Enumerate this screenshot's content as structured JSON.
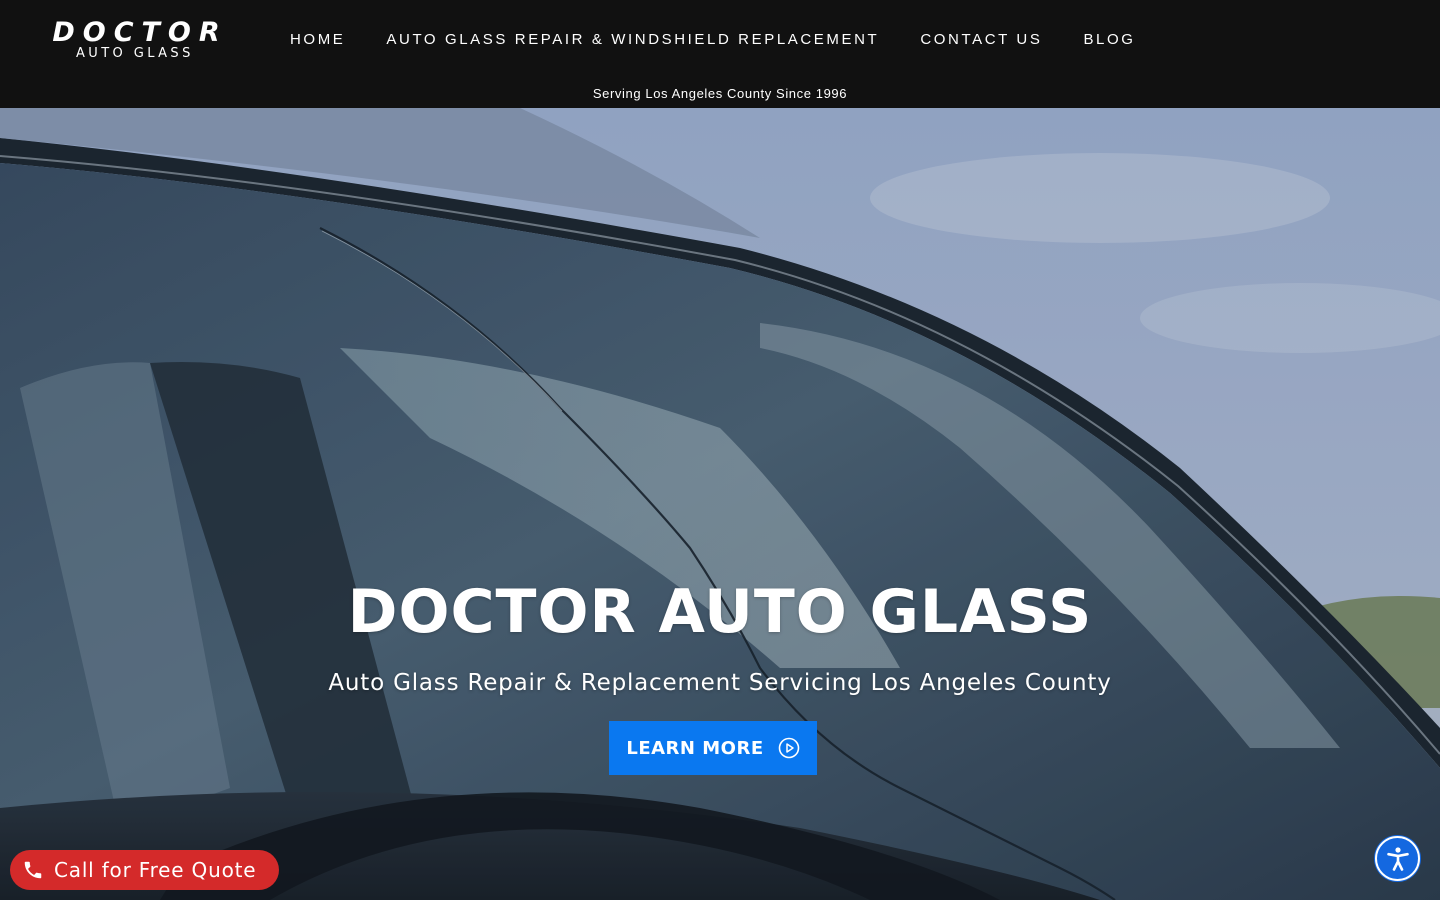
{
  "header": {
    "logo": {
      "main": "DOCTOR",
      "sub": "AUTO GLASS"
    },
    "nav": [
      {
        "label": "HOME"
      },
      {
        "label": "AUTO GLASS REPAIR & WINDSHIELD REPLACEMENT"
      },
      {
        "label": "CONTACT US"
      },
      {
        "label": "BLOG"
      }
    ],
    "tagline": "Serving Los Angeles County Since 1996"
  },
  "hero": {
    "title": "DOCTOR AUTO GLASS",
    "subtitle": "Auto Glass Repair & Replacement Servicing Los Angeles County",
    "cta": {
      "label": "LEARN MORE",
      "icon": "play-circle-icon"
    }
  },
  "floating": {
    "call": {
      "label": "Call for Free Quote",
      "icon": "phone-icon"
    },
    "accessibility": {
      "icon": "accessibility-icon"
    }
  },
  "colors": {
    "header_bg": "#111111",
    "cta_blue": "#0a78f0",
    "call_red": "#d42a2a",
    "accessibility_blue": "#1468e0"
  }
}
